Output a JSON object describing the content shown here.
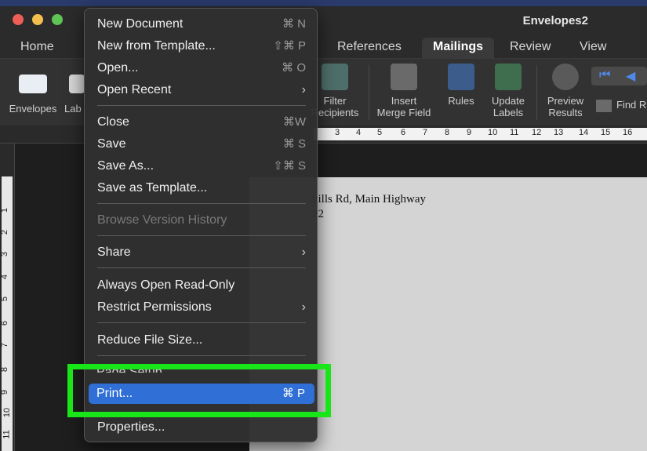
{
  "window": {
    "title": "Envelopes2"
  },
  "tabs": [
    {
      "label": "Home"
    },
    {
      "label": "References"
    },
    {
      "label": "Mailings"
    },
    {
      "label": "Review"
    },
    {
      "label": "View"
    }
  ],
  "ribbon": {
    "envelopes": "Envelopes",
    "labels_partial": "Lab",
    "filter_recipients": [
      "Filter",
      "Recipients"
    ],
    "insert_merge_field": [
      "Insert",
      "Merge Field"
    ],
    "rules": "Rules",
    "update_labels": [
      "Update",
      "Labels"
    ],
    "preview_results": [
      "Preview",
      "Results"
    ],
    "find_recipient_partial": "Find R"
  },
  "ruler": {
    "numbers": [
      "3",
      "4",
      "5",
      "6",
      "7",
      "8",
      "9",
      "10",
      "11",
      "12",
      "13",
      "14",
      "15",
      "16"
    ]
  },
  "vruler": {
    "numbers": [
      "1",
      "2",
      "3",
      "4",
      "5",
      "6",
      "7",
      "8",
      "9",
      "10",
      "11"
    ]
  },
  "document": {
    "address_line1": "hills Rd, Main Highway",
    "address_line2": "22"
  },
  "menu": {
    "new_document": {
      "label": "New Document",
      "shortcut": "⌘ N"
    },
    "new_from_template": {
      "label": "New from Template...",
      "shortcut": "⇧⌘ P"
    },
    "open": {
      "label": "Open...",
      "shortcut": "⌘ O"
    },
    "open_recent": {
      "label": "Open Recent"
    },
    "close": {
      "label": "Close",
      "shortcut": "⌘W"
    },
    "save": {
      "label": "Save",
      "shortcut": "⌘ S"
    },
    "save_as": {
      "label": "Save As...",
      "shortcut": "⇧⌘ S"
    },
    "save_as_template": {
      "label": "Save as Template..."
    },
    "browse_version_history": {
      "label": "Browse Version History"
    },
    "share": {
      "label": "Share"
    },
    "always_open_read_only": {
      "label": "Always Open Read-Only"
    },
    "restrict_permissions": {
      "label": "Restrict Permissions"
    },
    "reduce_file_size": {
      "label": "Reduce File Size..."
    },
    "page_setup": {
      "label": "Page Setup..."
    },
    "print": {
      "label": "Print...",
      "shortcut": "⌘ P"
    },
    "properties": {
      "label": "Properties..."
    }
  },
  "colors": {
    "highlight_box": "#19e619",
    "menu_selection": "#2f6fd6"
  }
}
